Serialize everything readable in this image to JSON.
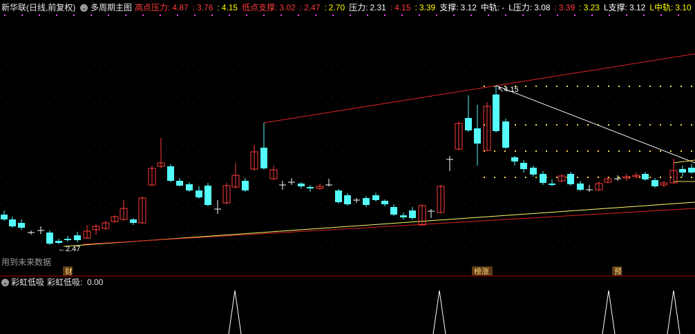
{
  "header": {
    "stock_title": "新华联(日线,前复权)",
    "panel_title": "多周期主图",
    "fields": [
      {
        "label": "高点压力:",
        "value": "4.87",
        "label_color": "#ff3b3b",
        "value_color": "#ff3b3b"
      },
      {
        "label": ":",
        "value": "3.76",
        "label_color": "#ff3b3b",
        "value_color": "#ff3b3b"
      },
      {
        "label": ":",
        "value": "4.15",
        "label_color": "#ffff00",
        "value_color": "#ffff00"
      },
      {
        "label": "低点支撑:",
        "value": "3.02",
        "label_color": "#ff3b3b",
        "value_color": "#ff3b3b"
      },
      {
        "label": ":",
        "value": "2.47",
        "label_color": "#ff3b3b",
        "value_color": "#ff3b3b"
      },
      {
        "label": ":",
        "value": "2.70",
        "label_color": "#ffff00",
        "value_color": "#ffff00"
      },
      {
        "label": "压力:",
        "value": "2.31",
        "label_color": "#ffffff",
        "value_color": "#ffffff"
      },
      {
        "label": ":",
        "value": "4.15",
        "label_color": "#ff3b3b",
        "value_color": "#ff3b3b"
      },
      {
        "label": ":",
        "value": "3.39",
        "label_color": "#ffff00",
        "value_color": "#ffff00"
      },
      {
        "label": "支撑:",
        "value": "3.12",
        "label_color": "#ffffff",
        "value_color": "#ffffff"
      },
      {
        "label": "中轨:",
        "value": "-",
        "label_color": "#ffffff",
        "value_color": "#ffffff"
      },
      {
        "label": "L压力:",
        "value": "3.08",
        "label_color": "#ffffff",
        "value_color": "#ffffff"
      },
      {
        "label": ":",
        "value": "3.39",
        "label_color": "#ff3b3b",
        "value_color": "#ff3b3b"
      },
      {
        "label": ":",
        "value": "3.23",
        "label_color": "#ffff00",
        "value_color": "#ffff00"
      },
      {
        "label": "L支撑:",
        "value": "3.12",
        "label_color": "#ffffff",
        "value_color": "#ffffff"
      },
      {
        "label": "L中轨:",
        "value": "3.10",
        "label_color": "#ffff00",
        "value_color": "#ffff00"
      }
    ]
  },
  "annotations": {
    "high_price": "4.15",
    "low_price": "2.47",
    "future_data_notice": "用到未来数据",
    "tag_cai": "财",
    "tag_bangzhang": "榜涨",
    "tag_yu": "预"
  },
  "subpanel": {
    "title": "彩虹低吸",
    "value_label": "彩虹低吸:",
    "value": "0.00"
  },
  "colors": {
    "background": "#000000",
    "up_candle": "#ff3b3b",
    "down_candle": "#54fcfc",
    "doji": "#ffffff",
    "upper_line": "#dd2222",
    "lower_line": "#ffff66",
    "divider": "#b00000",
    "tag_bg": "#5c3a16",
    "tag_text": "#ffd479"
  },
  "chart_data": {
    "type": "candlestick",
    "price_high": 4.15,
    "price_low": 2.47,
    "signal_values": [
      0,
      0,
      0,
      0,
      0,
      1,
      0,
      0,
      0,
      0,
      1,
      0,
      0,
      0,
      1,
      0,
      1
    ]
  }
}
